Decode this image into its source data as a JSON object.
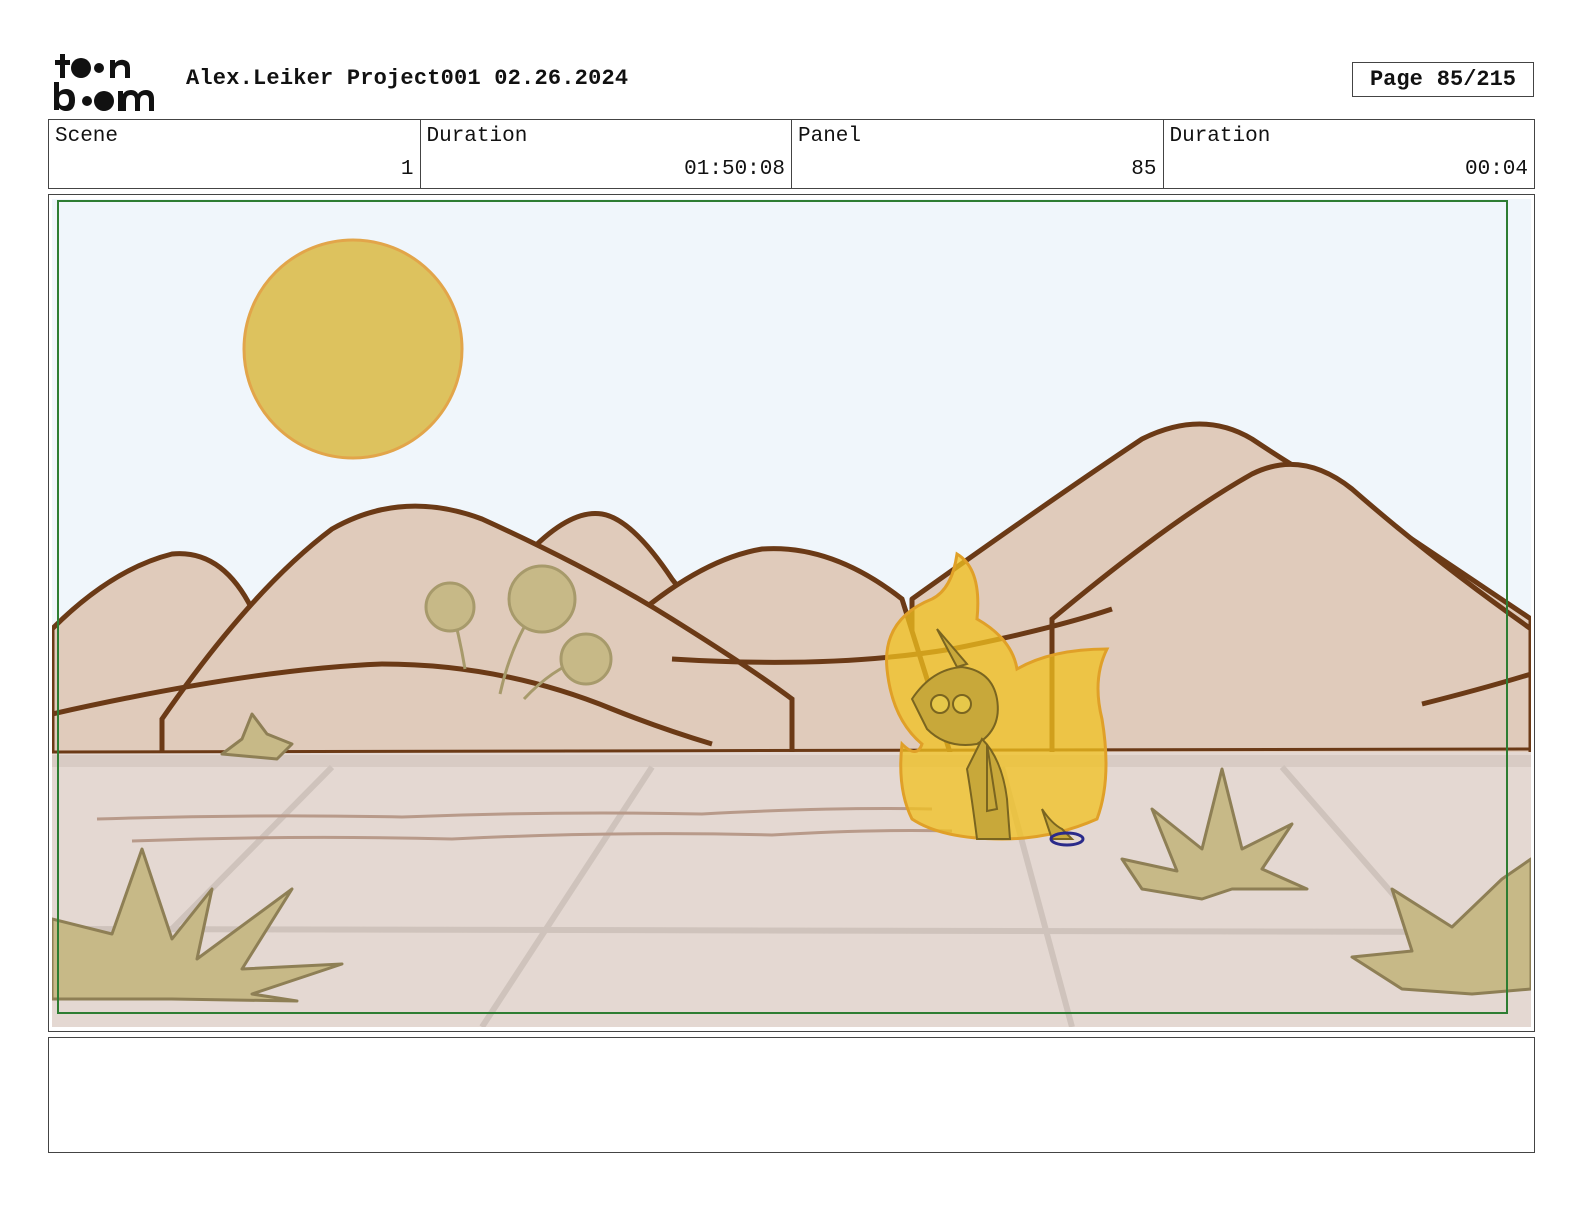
{
  "header": {
    "logo_text": "toon boom",
    "title": "Alex.Leiker Project001 02.26.2024",
    "page_label": "Page",
    "page_value": "85/215"
  },
  "info": {
    "scene_label": "Scene",
    "scene_value": "1",
    "scene_duration_label": "Duration",
    "scene_duration_value": "01:50:08",
    "panel_label": "Panel",
    "panel_value": "85",
    "panel_duration_label": "Duration",
    "panel_duration_value": "00:04"
  },
  "panel": {
    "description": "",
    "colors": {
      "sky": "#f0f6fb",
      "sun": "#ddc25e",
      "hills": "#e0cbbb",
      "hill_outline": "#6b3a16",
      "ground": "#e4d8d2",
      "grass": "#c7b987",
      "flame": "#f2c21f",
      "safe_frame": "#2e7d32"
    }
  },
  "notes": {
    "text": ""
  }
}
